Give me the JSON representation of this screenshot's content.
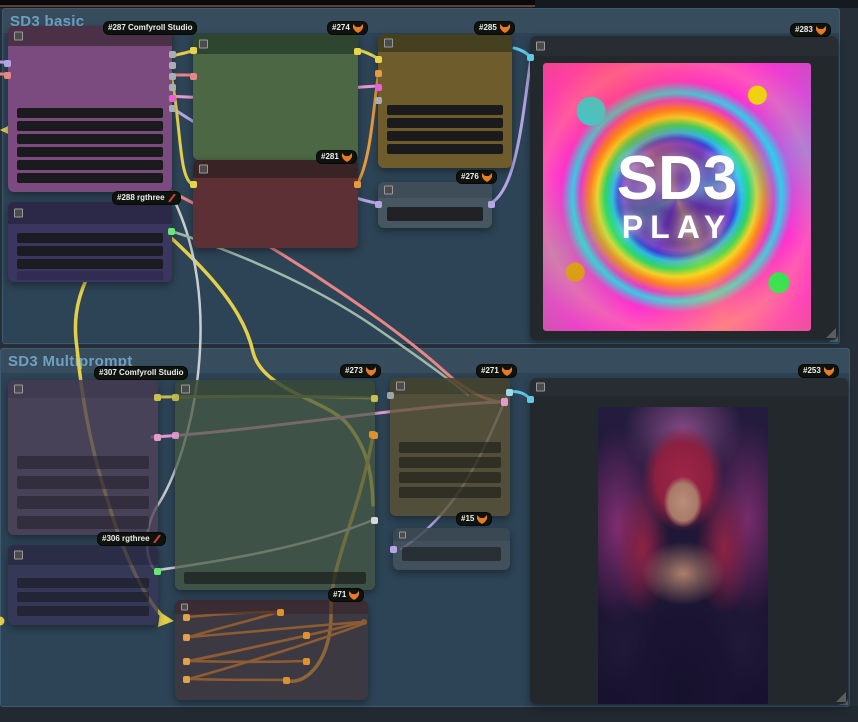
{
  "groups": {
    "basic": {
      "title": "SD3 basic"
    },
    "multi": {
      "title": "SD3 Multiprompt"
    }
  },
  "badges": {
    "b287": {
      "label": "#287 Comfyroll Studio",
      "icon": "none"
    },
    "b274": {
      "label": "#274",
      "icon": "fox"
    },
    "b285": {
      "label": "#285",
      "icon": "fox"
    },
    "b283": {
      "label": "#283",
      "icon": "fox"
    },
    "b281": {
      "label": "#281",
      "icon": "fox"
    },
    "b276": {
      "label": "#276",
      "icon": "fox"
    },
    "b288": {
      "label": "#288 rgthree",
      "icon": "rgthree"
    },
    "b307": {
      "label": "#307 Comfyroll Studio",
      "icon": "none"
    },
    "b273": {
      "label": "#273",
      "icon": "fox"
    },
    "b271": {
      "label": "#271",
      "icon": "fox"
    },
    "b253": {
      "label": "#253",
      "icon": "fox"
    },
    "b306": {
      "label": "#306 rgthree",
      "icon": "rgthree"
    },
    "b15": {
      "label": "#15",
      "icon": "fox"
    },
    "b71": {
      "label": "#71",
      "icon": "fox"
    }
  },
  "images": {
    "sd3_play": {
      "title": "SD3",
      "subtitle": "PLAY"
    }
  },
  "colors": {
    "group_title": "#6fa0c2",
    "noodle_yellow": "#e3cf4b",
    "noodle_salmon": "#e88585",
    "noodle_pink": "#e59ad0",
    "noodle_lavender": "#b3a6e3",
    "noodle_cyan": "#5fc9e8",
    "noodle_orange": "#e0912f",
    "noodle_white": "#c9cdd2",
    "dot_green": "#66e873",
    "badge_bg": "#0e140d"
  }
}
